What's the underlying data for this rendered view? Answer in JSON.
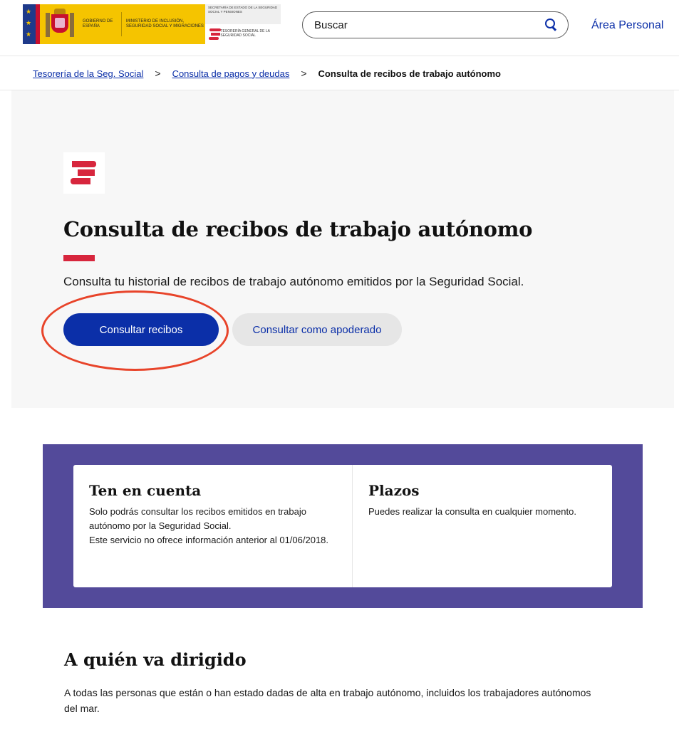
{
  "header": {
    "gov_logo": {
      "gobierno": "Gobierno de España",
      "ministerio": "Ministerio de Inclusión, Seguridad Social y Migraciones"
    },
    "secretaria": {
      "text": "Secretaría de Estado de la Seguridad Social y Pensiones",
      "tgss": "Tesorería General de la Seguridad Social"
    },
    "search": {
      "placeholder": "Buscar"
    },
    "area_personal": "Área Personal"
  },
  "breadcrumb": {
    "items": [
      "Tesorería de la Seg. Social",
      "Consulta de pagos y deudas"
    ],
    "current": "Consulta de recibos de trabajo autónomo",
    "separator": ">"
  },
  "hero": {
    "title": "Consulta de recibos de trabajo autónomo",
    "description": "Consulta tu historial de recibos de trabajo autónomo emitidos por la Seguridad Social.",
    "primary_button": "Consultar recibos",
    "secondary_button": "Consultar como apoderado"
  },
  "info": {
    "left": {
      "title": "Ten en cuenta",
      "line1": "Solo podrás consultar los recibos emitidos en trabajo autónomo por la Seguridad Social.",
      "line2": "Este servicio no ofrece información anterior al 01/06/2018."
    },
    "right": {
      "title": "Plazos",
      "text": "Puedes realizar la consulta en cualquier momento."
    }
  },
  "audience": {
    "title": "A quién va dirigido",
    "text": "A todas las personas que están o han estado dadas de alta en trabajo autónomo, incluidos los trabajadores autónomos del mar."
  },
  "colors": {
    "primary_blue": "#0b2fa8",
    "brand_red": "#d7263d",
    "panel_purple": "#534a9a",
    "annotation_red": "#e8442a",
    "gov_yellow": "#f5c400"
  }
}
